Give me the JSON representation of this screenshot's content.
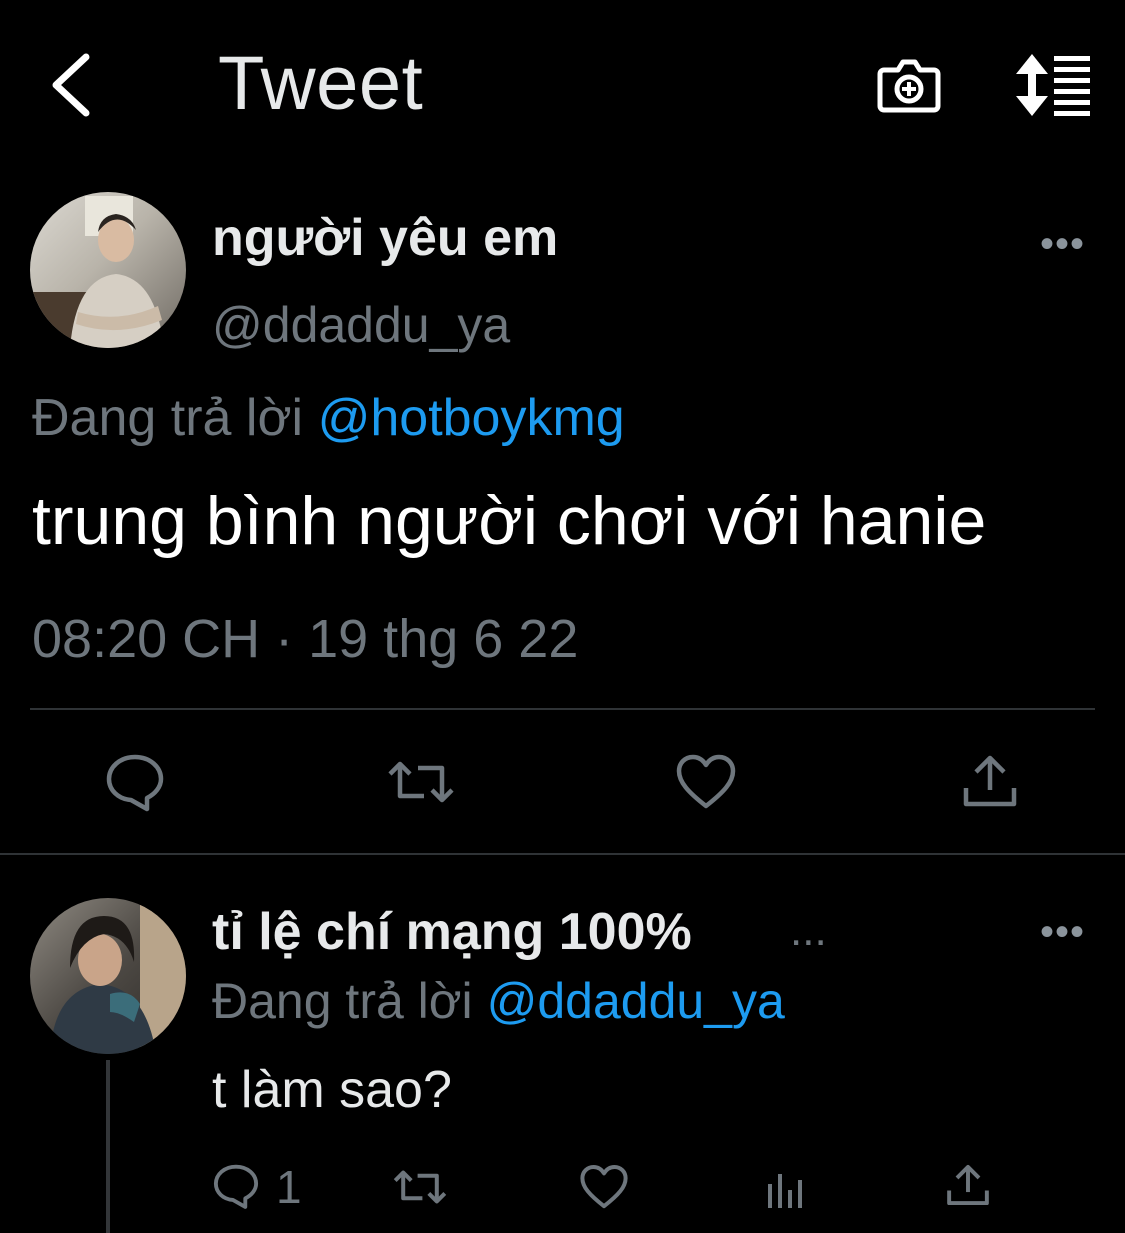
{
  "header": {
    "title": "Tweet",
    "back_icon": "chevron-left-icon",
    "camera_icon": "camera-plus-icon",
    "sort_icon": "sort-list-icon"
  },
  "main_tweet": {
    "display_name": "người yêu em",
    "handle": "@ddaddu_ya",
    "reply_prefix": "Đang trả lời",
    "reply_to": "@hotboykmg",
    "text": "trung bình người chơi với hanie",
    "timestamp": "08:20 CH · 19 thg 6 22",
    "more": "•••"
  },
  "reply_tweet": {
    "display_name": "tỉ lệ chí mạng 100%",
    "name_ellipsis": "...",
    "reply_prefix": "Đang trả lời",
    "reply_to": "@ddaddu_ya",
    "text": "t làm sao?",
    "reply_count": "1",
    "more": "•••"
  },
  "colors": {
    "background": "#000000",
    "text_primary": "#e7e9ea",
    "text_secondary": "#6e767d",
    "accent": "#1d9bf0",
    "divider": "#2f3336"
  }
}
